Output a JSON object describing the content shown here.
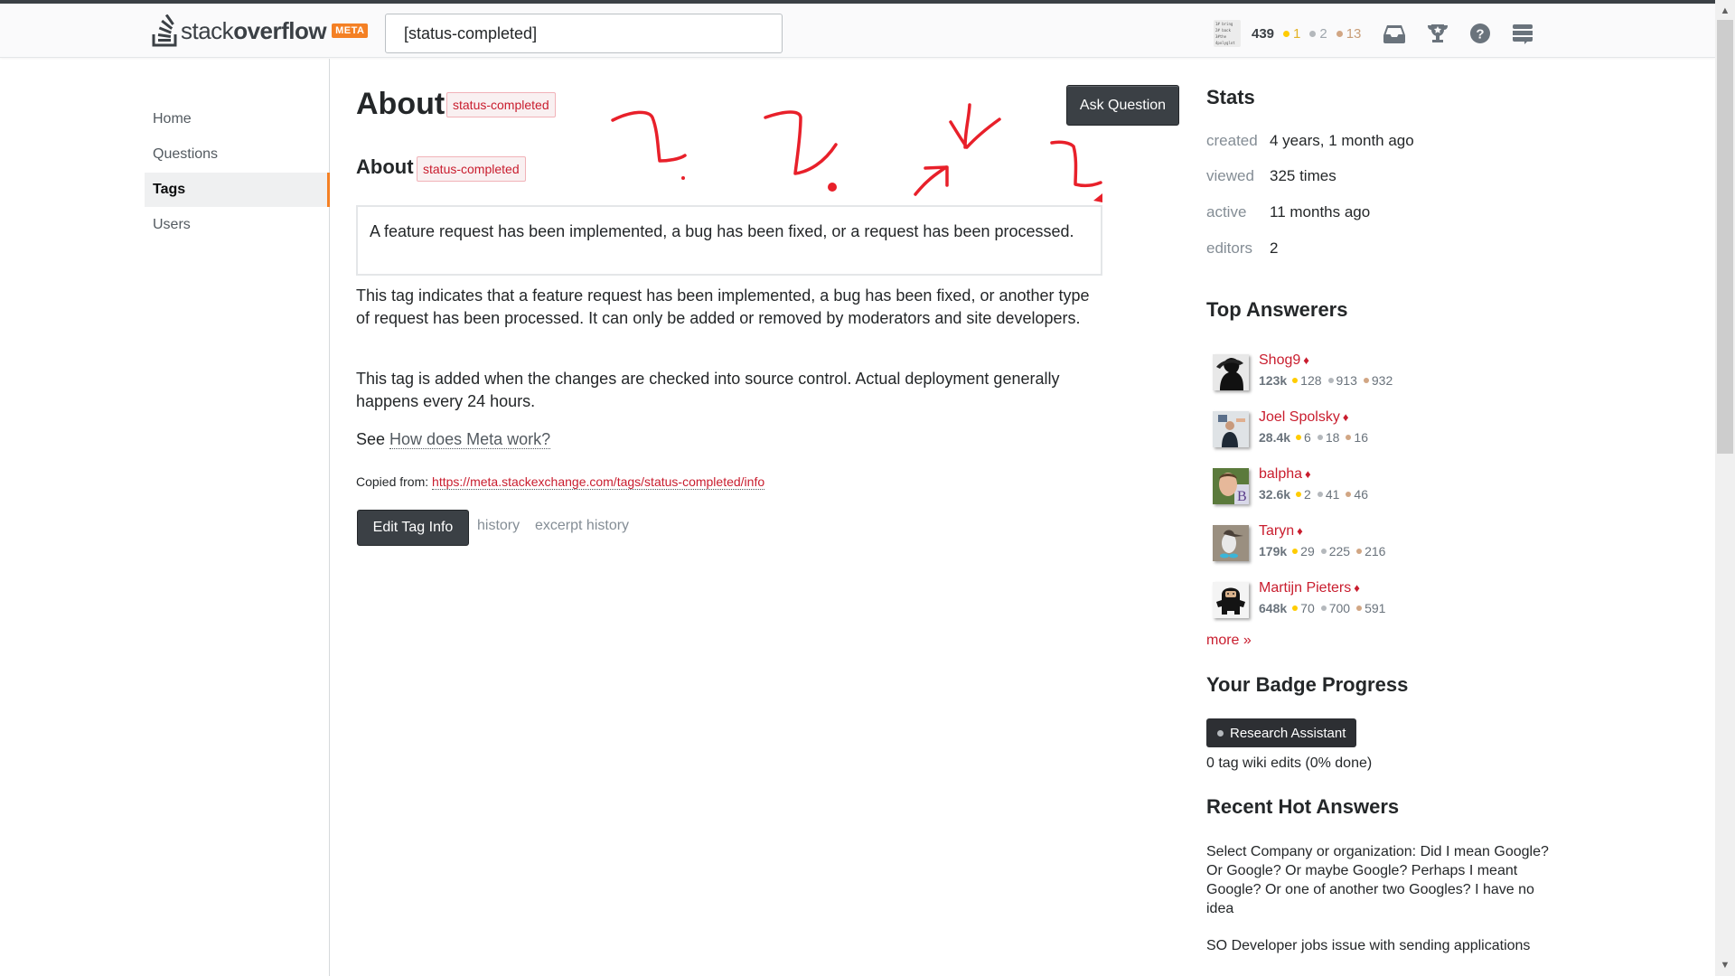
{
  "header": {
    "logo": {
      "light": "stack",
      "bold": "overflow",
      "badge": "META"
    },
    "search_value": "[status-completed]",
    "user": {
      "avatar_text": "1# bring\n2# back\n3#the\n4polyglot",
      "reputation": "439",
      "gold": "1",
      "silver": "2",
      "bronze": "13"
    },
    "icons": [
      "inbox-icon",
      "achievements-icon",
      "help-icon",
      "site-switcher-icon"
    ]
  },
  "nav": {
    "items": [
      {
        "label": "Home",
        "active": false
      },
      {
        "label": "Questions",
        "active": false
      },
      {
        "label": "Tags",
        "active": true
      },
      {
        "label": "Users",
        "active": false
      }
    ]
  },
  "main": {
    "title": "About",
    "tag": "status-completed",
    "subtitle": "About",
    "ask_question": "Ask Question",
    "excerpt": "A feature request has been implemented, a bug has been fixed, or a request has been processed.",
    "paragraphs": [
      "This tag indicates that a feature request has been implemented, a bug has been fixed, or another type of request has been processed. It can only be added or removed by moderators and site developers.",
      "This tag is added when the changes are checked into source control. Actual deployment generally happens every 24 hours."
    ],
    "see_prefix": "See",
    "see_link": "How does Meta work?",
    "copied_label": "Copied from:",
    "copied_url": "https://meta.stackexchange.com/tags/status-completed/info",
    "edit_button": "Edit Tag Info",
    "history_link": "history",
    "excerpt_history_link": "excerpt history"
  },
  "sidebar": {
    "stats_title": "Stats",
    "stats": [
      {
        "label": "created",
        "value": "4 years, 1 month ago"
      },
      {
        "label": "viewed",
        "value": "325 times"
      },
      {
        "label": "active",
        "value": "11 months ago"
      },
      {
        "label": "editors",
        "value": "2"
      }
    ],
    "top_answerers_title": "Top Answerers",
    "answerers": [
      {
        "name": "Shog9",
        "diamond": "♦",
        "rep": "123k",
        "gold": "128",
        "silver": "913",
        "bronze": "932"
      },
      {
        "name": "Joel Spolsky",
        "diamond": "♦",
        "rep": "28.4k",
        "gold": "6",
        "silver": "18",
        "bronze": "16"
      },
      {
        "name": "balpha",
        "diamond": "♦",
        "rep": "32.6k",
        "gold": "2",
        "silver": "41",
        "bronze": "46"
      },
      {
        "name": "Taryn",
        "diamond": "♦",
        "rep": "179k",
        "gold": "29",
        "silver": "225",
        "bronze": "216"
      },
      {
        "name": "Martijn Pieters",
        "diamond": "♦",
        "rep": "648k",
        "gold": "70",
        "silver": "700",
        "bronze": "591"
      }
    ],
    "more_link": "more »",
    "badge_progress_title": "Your Badge Progress",
    "badge_name": "Research Assistant",
    "badge_progress_text": "0 tag wiki edits (0% done)",
    "badge_progress_percent": 0,
    "recent_hot_title": "Recent Hot Answers",
    "recent_hot": [
      "Select Company or organization: Did I mean Google? Or Google? Or maybe Google? Perhaps I meant Google? Or one of another two Googles? I have no idea",
      "SO Developer jobs issue with sending applications"
    ]
  },
  "colors": {
    "accent": "#f48024",
    "tag_text": "#c91d2e",
    "annotation": "#e8202a"
  }
}
